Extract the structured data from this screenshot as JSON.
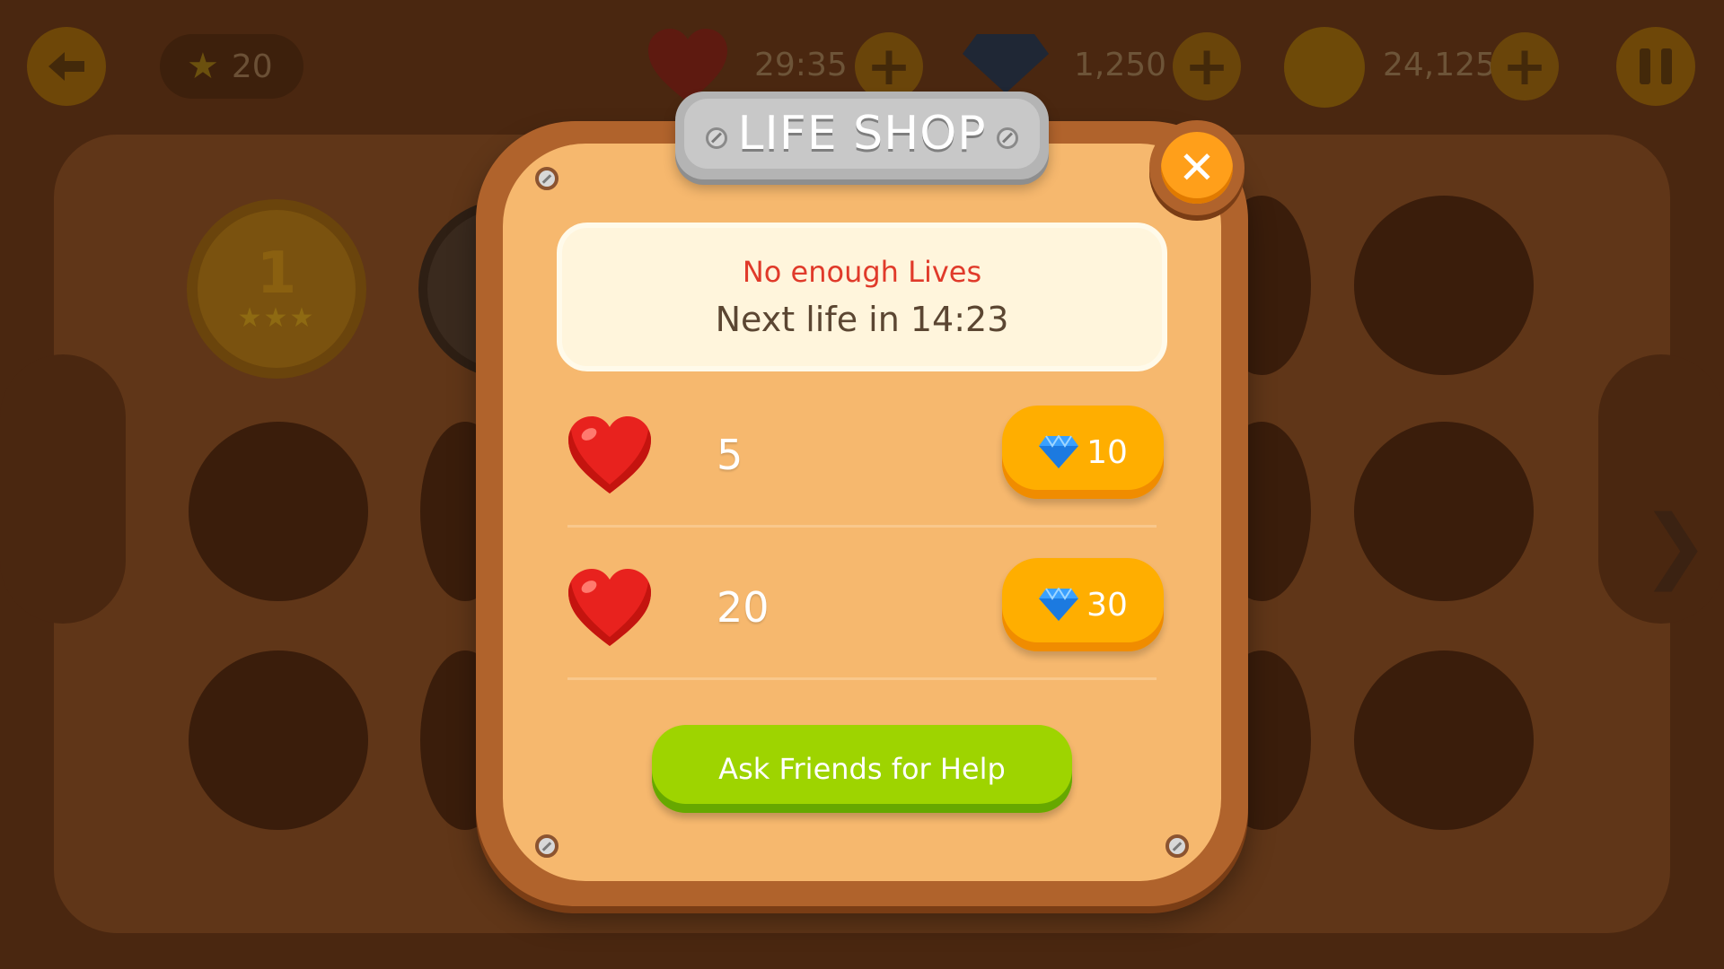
{
  "hud": {
    "back_icon": "arrow-left-icon",
    "stars": "20",
    "lives_timer": "29:35",
    "gems": "1,250",
    "coins": "24,125",
    "pause_icon": "pause-icon"
  },
  "background_levels": {
    "level1_number": "1",
    "level1_stars": "★★★"
  },
  "modal": {
    "title": "LIFE SHOP",
    "close_icon": "close-icon",
    "warning": "No enough Lives",
    "next_life": "Next life in 14:23",
    "offers": [
      {
        "lives": "5",
        "price": "10"
      },
      {
        "lives": "20",
        "price": "30"
      }
    ],
    "ask_button": "Ask Friends for Help"
  },
  "colors": {
    "warning": "#e03a2a",
    "buy_button": "#ffae00",
    "ask_button": "#9ed400",
    "panel": "#f6b86e",
    "frame": "#b0632c"
  }
}
